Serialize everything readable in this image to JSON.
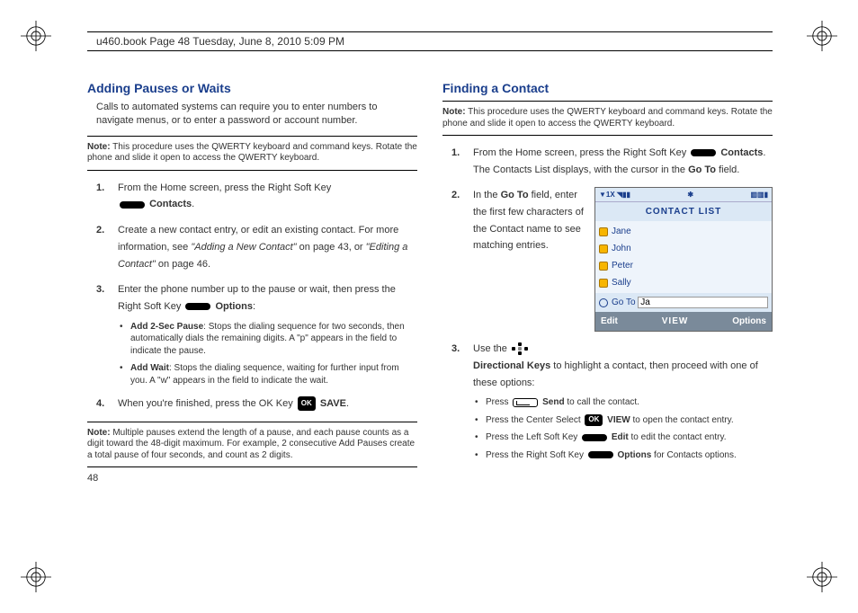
{
  "header": {
    "running_head": "u460.book  Page 48  Tuesday, June 8, 2010  5:09 PM"
  },
  "left": {
    "heading": "Adding Pauses or Waits",
    "intro": "Calls to automated systems can require you to enter numbers to navigate menus, or to enter a password or account number.",
    "note1_label": "Note:",
    "note1": "This procedure uses the QWERTY keyboard and command keys. Rotate the phone and slide it open to access the QWERTY keyboard.",
    "step1a": "From the Home screen, press the Right Soft Key ",
    "step1b": "Contacts",
    "step1c": ".",
    "step2a": "Create a new contact entry, or edit an existing contact. For more information, see ",
    "step2b": "\"Adding a New Contact\"",
    "step2c": " on page 43, or ",
    "step2d": "\"Editing a Contact\"",
    "step2e": " on page 46.",
    "step3a": "Enter the phone number up to the pause or wait, then press the Right Soft Key ",
    "step3b": "Options",
    "step3c": ":",
    "bullet1a": "Add 2-Sec Pause",
    "bullet1b": ": Stops the dialing sequence for two seconds, then automatically dials the remaining digits. A \"p\" appears in the field to indicate the pause.",
    "bullet2a": "Add Wait",
    "bullet2b": ": Stops the dialing sequence, waiting for further input from you. A \"w\" appears in the field to indicate the wait.",
    "step4a": "When you're finished, press the OK Key ",
    "step4_ok": "OK",
    "step4b": "SAVE",
    "step4c": ".",
    "note2_label": "Note:",
    "note2": "Multiple pauses extend the length of a pause, and each pause counts as a digit toward the 48-digit maximum. For example, 2 consecutive Add Pauses create a total pause of four seconds, and count as 2 digits."
  },
  "right": {
    "heading": "Finding a Contact",
    "note1_label": "Note:",
    "note1": "This procedure uses the QWERTY keyboard and command keys. Rotate the phone and slide it open to access the QWERTY keyboard.",
    "step1a": "From the Home screen, press the Right Soft Key ",
    "step1b": "Contacts",
    "step1c": ". The Contacts List displays, with the cursor in the ",
    "step1d": "Go To",
    "step1e": " field.",
    "step2a": "In the ",
    "step2b": "Go To",
    "step2c": " field, enter the first few characters of the Contact name to see matching entries.",
    "step3a": "Use the ",
    "step3b": "Directional Keys",
    "step3c": " to highlight a contact, then proceed with one of these options:",
    "b1a": "Press ",
    "b1b": "Send",
    "b1c": " to call the contact.",
    "b2a": "Press the Center Select ",
    "b2_ok": "OK",
    "b2b": "VIEW",
    "b2c": " to open the contact entry.",
    "b3a": "Press the Left Soft Key ",
    "b3b": "Edit",
    "b3c": " to edit the contact entry.",
    "b4a": "Press the Right Soft Key ",
    "b4b": "Options",
    "b4c": " for Contacts options."
  },
  "phone": {
    "status_left": "▼1X ◥▮▮",
    "status_mid": "✱",
    "status_right": "▥▥▮",
    "title": "CONTACT LIST",
    "items": [
      "Jane",
      "John",
      "Peter",
      "Sally"
    ],
    "goto_label": "Go To",
    "goto_value": "Ja",
    "soft_left": "Edit",
    "soft_mid": "VIEW",
    "soft_right": "Options"
  },
  "page_number": "48"
}
